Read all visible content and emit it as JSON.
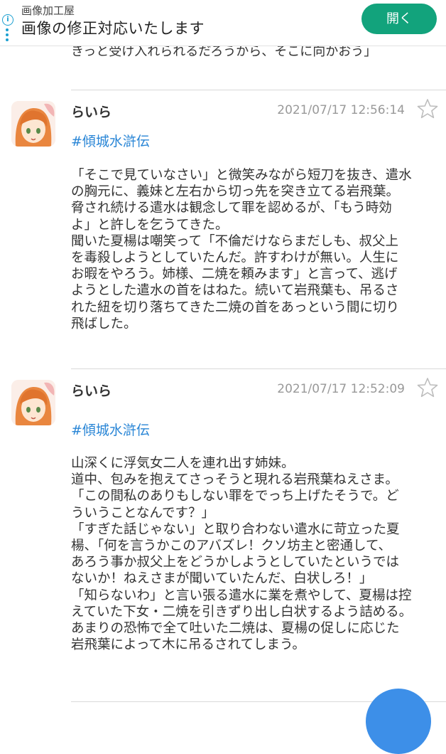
{
  "ad": {
    "subtitle": "画像加工屋",
    "title": "画像の修正対応いたします",
    "button": "開く",
    "info_icon": "info-icon",
    "accent": "#12a37c"
  },
  "peek_text": "きっと受け入れられるだろうから、そこに向かおう」",
  "posts": [
    {
      "user": "らいら",
      "date": "2021/07/17 12:56:14",
      "tag": "#傾城水滸伝",
      "lines": [
        "「そこで見ていなさい」と微笑みながら短刀を抜き、遣水",
        "の胸元に、義妹と左右から切っ先を突き立てる岩飛葉。",
        "脅され続ける遣水は観念して罪を認めるが、「もう時効",
        "よ」と許しを乞うてきた。",
        "聞いた夏楊は嘲笑って「不倫だけならまだしも、叔父上",
        "を毒殺しようとしていたんだ。許すわけが無い。人生に",
        "お暇をやろう。姉様、二焼を頼みます」と言って、逃げ",
        "ようとした遣水の首をはねた。続いて岩飛葉も、吊るさ",
        "れた紐を切り落ちてきた二焼の首をあっという間に切り",
        "飛ばした。"
      ]
    },
    {
      "user": "らいら",
      "date": "2021/07/17 12:52:09",
      "tag": "#傾城水滸伝",
      "lines": [
        "山深くに浮気女二人を連れ出す姉妹。",
        "道中、包みを抱えてさっそうと現れる岩飛葉ねえさま。",
        "「この間私のありもしない罪をでっち上げたそうで。ど",
        "ういうことなんです？」",
        "「すぎた話じゃない」と取り合わない遣水に苛立った夏",
        "楊、「何を言うかこのアバズレ！クソ坊主と密通して、",
        "あろう事か叔父上をどうかしようとしていたというでは",
        "ないか！ねえさまが聞いていたんだ、白状しろ！」",
        "「知らないわ」と言い張る遣水に業を煮やして、夏楊は控",
        "えていた下女・二焼を引きずり出し白状するよう詰める。",
        "あまりの恐怖で全て吐いた二焼は、夏楊の促しに応じた",
        "岩飛葉によって木に吊るされてしまう。"
      ]
    }
  ]
}
